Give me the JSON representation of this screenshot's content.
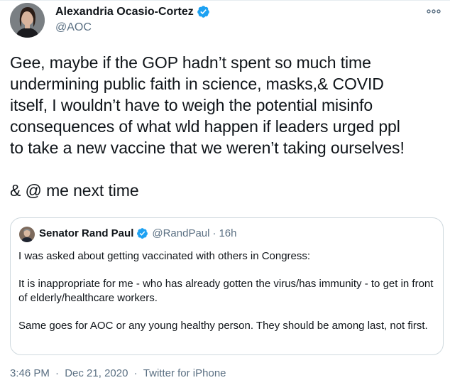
{
  "author": {
    "name": "Alexandria Ocasio-Cortez",
    "handle": "@AOC",
    "verified": true,
    "avatar_icon": "person-avatar-icon"
  },
  "tweet": {
    "lines": [
      "Gee, maybe if the GOP hadn’t spent so much time",
      "undermining public faith in science, masks,& COVID",
      "itself, I wouldn’t have to weigh the potential misinfo",
      "consequences of what wld happen if leaders urged ppl",
      "to take a new vaccine that we weren’t taking ourselves!",
      "& @ me next time"
    ]
  },
  "quoted_tweet": {
    "name": "Senator Rand Paul",
    "handle": "@RandPaul",
    "separator": "·",
    "time": "16h",
    "verified": true,
    "paragraphs": [
      "I was asked about getting vaccinated with others in Congress:",
      "It is inappropriate for me - who has already gotten the virus/has immunity - to get in front of elderly/healthcare workers.",
      "Same goes for AOC or any young healthy person. They should be among last, not first."
    ]
  },
  "meta": {
    "time": "3:46 PM",
    "separator": "·",
    "date": "Dec 21, 2020",
    "source": "Twitter for iPhone"
  },
  "colors": {
    "verified_blue": "#1da1f2",
    "secondary_text": "#5b7083",
    "border": "#cfd9de"
  }
}
